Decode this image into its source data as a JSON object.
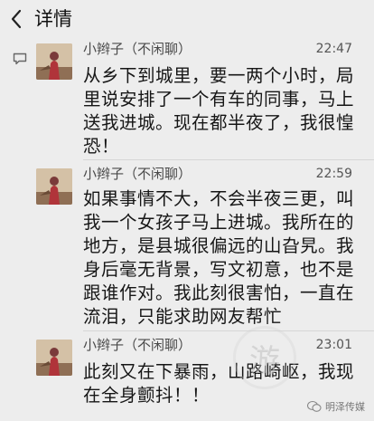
{
  "header": {
    "title": "详情"
  },
  "messages": [
    {
      "sender": "小辫子（不闲聊）",
      "time": "22:47",
      "text": "从乡下到城里，要一两个小时，局里说安排了一个有车的同事，马上送我进城。现在都半夜了，我很惶恐！"
    },
    {
      "sender": "小辫子（不闲聊）",
      "time": "22:59",
      "text": "如果事情不大，不会半夜三更，叫我一个女孩子马上进城。我所在的地方，是县城很偏远的山旮旯。我身后毫无背景，写文初意，也不是跟谁作对。我此刻很害怕，一直在流泪，只能求助网友帮忙"
    },
    {
      "sender": "小辫子（不闲聊）",
      "time": "23:01",
      "text": "此刻又在下暴雨，山路崎岖，我现在全身颤抖！！"
    }
  ],
  "watermark": {
    "center_glyph": "游",
    "brand": "明泽传媒"
  },
  "colors": {
    "background": "#ededed",
    "text": "#161616",
    "meta": "#555555"
  }
}
